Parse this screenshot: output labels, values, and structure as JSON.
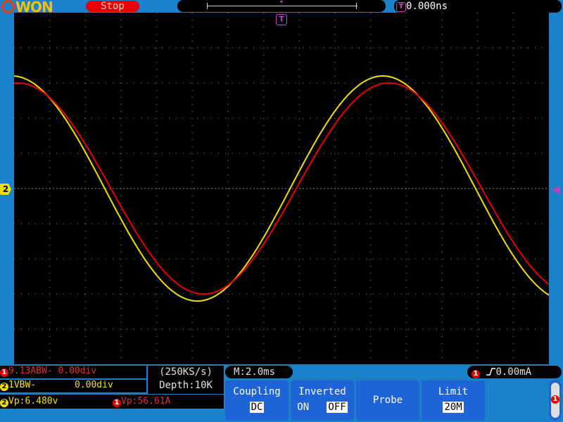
{
  "brand": {
    "logo_text": "WON"
  },
  "status": {
    "run_state": "Stop"
  },
  "trigger": {
    "time_badge": "T",
    "time_offset": "0.000ns",
    "marker_label": "T"
  },
  "channels": {
    "ch1": {
      "number": "1",
      "scale": "9.13ABW- 0.00div",
      "measurement": "Vp:56.61A",
      "color": "#e60000"
    },
    "ch2": {
      "number": "2",
      "scale": "1VBW-",
      "offset": "0.00div",
      "measurement": "Vp:6.480v",
      "color": "#f0e000"
    }
  },
  "acquisition": {
    "sample_rate": "(250KS/s)",
    "depth": "Depth:10K",
    "timebase": "M:2.0ms"
  },
  "trigger_info": {
    "channel": "1",
    "level": "0.00mA"
  },
  "menu": {
    "coupling": {
      "label": "Coupling",
      "value": "DC"
    },
    "inverted": {
      "label": "Inverted",
      "on": "ON",
      "off": "OFF"
    },
    "probe": {
      "label": "Probe"
    },
    "limit": {
      "label": "Limit",
      "value": "20M"
    },
    "side_channel": "1"
  },
  "chart_data": {
    "type": "line",
    "grid": true,
    "x_divisions": 15,
    "y_divisions": 10,
    "series": [
      {
        "channel": "2",
        "color": "#f0e000",
        "amplitude_div": 3.2,
        "period_div": 10.4,
        "phase_deg": 92
      },
      {
        "channel": "1",
        "color": "#e60000",
        "amplitude_div": 3.0,
        "period_div": 10.4,
        "phase_deg": 86
      }
    ]
  }
}
